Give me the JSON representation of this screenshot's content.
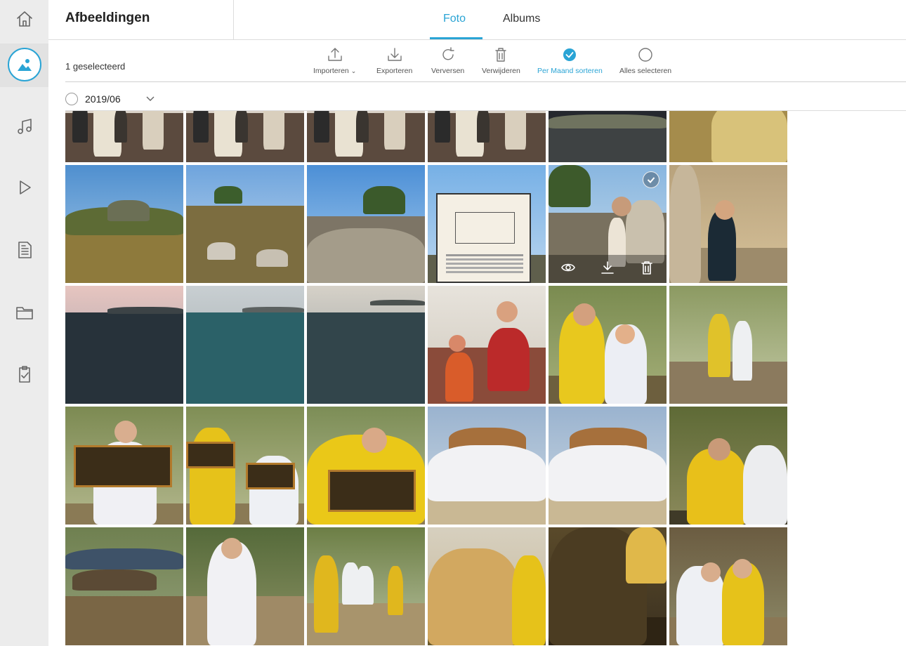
{
  "app": {
    "title": "Afbeeldingen"
  },
  "tabs": [
    {
      "label": "Foto",
      "active": true
    },
    {
      "label": "Albums",
      "active": false
    }
  ],
  "sidebar": {
    "items": [
      {
        "name": "home",
        "icon": "home-icon"
      },
      {
        "name": "images",
        "icon": "image-icon",
        "active": true
      },
      {
        "name": "music",
        "icon": "music-icon"
      },
      {
        "name": "video",
        "icon": "play-icon"
      },
      {
        "name": "documents",
        "icon": "document-icon"
      },
      {
        "name": "folders",
        "icon": "folder-icon"
      },
      {
        "name": "tasks",
        "icon": "clipboard-check-icon"
      }
    ]
  },
  "toolbar": {
    "selected_count": "1 geselecteerd",
    "import_label": "Importeren",
    "export_label": "Exporteren",
    "refresh_label": "Verversen",
    "delete_label": "Verwijderen",
    "sort_label": "Per Maand sorteren",
    "select_all_label": "Alles selecteren"
  },
  "month": {
    "label": "2019/06"
  },
  "colors": {
    "accent": "#2aa4d5",
    "rail_bg": "#ececec"
  },
  "photo_actions": [
    "eye-icon",
    "download-icon",
    "trash-icon"
  ],
  "photos": [
    {
      "scene": "museum",
      "row": 1
    },
    {
      "scene": "museum",
      "row": 1
    },
    {
      "scene": "museum",
      "row": 1
    },
    {
      "scene": "museum",
      "row": 1
    },
    {
      "scene": "night-ruins",
      "row": 1
    },
    {
      "scene": "hillside",
      "row": 1
    },
    {
      "scene": "mountain-valley",
      "row": 2
    },
    {
      "scene": "ruins-field",
      "row": 2
    },
    {
      "scene": "ancient-theater",
      "row": 2
    },
    {
      "scene": "info-sign",
      "row": 2
    },
    {
      "scene": "woman-ruins",
      "row": 2,
      "selected": true
    },
    {
      "scene": "woman-column",
      "row": 2
    },
    {
      "scene": "sea-dusk",
      "row": 3
    },
    {
      "scene": "sea-clear",
      "row": 3
    },
    {
      "scene": "sea-calm",
      "row": 3
    },
    {
      "scene": "tasting",
      "row": 3
    },
    {
      "scene": "beekeepers-pair",
      "row": 3
    },
    {
      "scene": "beekeepers-walk",
      "row": 3
    },
    {
      "scene": "frame-hold",
      "row": 4
    },
    {
      "scene": "frame-two",
      "row": 4
    },
    {
      "scene": "frame-hold2",
      "row": 4
    },
    {
      "scene": "group",
      "row": 4
    },
    {
      "scene": "group",
      "row": 4
    },
    {
      "scene": "beekeeper-close",
      "row": 4
    },
    {
      "scene": "picnic",
      "row": 5
    },
    {
      "scene": "suit-wave",
      "row": 5
    },
    {
      "scene": "walk-group",
      "row": 5
    },
    {
      "scene": "glove",
      "row": 5
    },
    {
      "scene": "honeycomb",
      "row": 5
    },
    {
      "scene": "suits-hut",
      "row": 5
    }
  ]
}
